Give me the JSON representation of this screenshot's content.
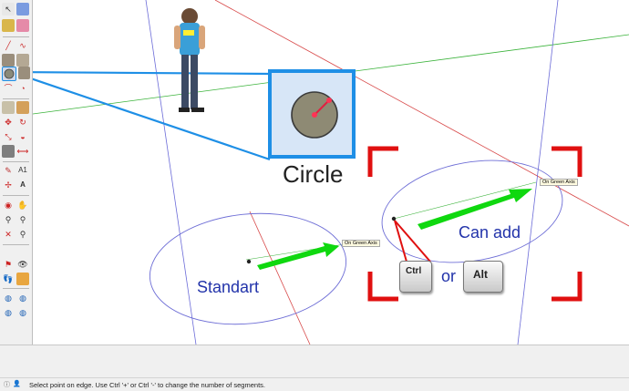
{
  "status_bar": {
    "message": "Select point on edge. Use Ctrl '+' or Ctrl '-' to change the number of segments.",
    "icons": [
      "info-icon",
      "user-icon"
    ]
  },
  "callout": {
    "title": "Circle",
    "icon": "circle-tool-icon"
  },
  "inference_tags": {
    "left": "On Green Axis",
    "right": "On Green Axis"
  },
  "labels": {
    "standart": "Standart",
    "can_add": "Can add",
    "or": "or"
  },
  "keys": {
    "ctrl": "Ctrl",
    "alt": "Alt"
  },
  "colors": {
    "axis_green": "#3bb33b",
    "axis_red": "#d84a4a",
    "axis_blue": "#6b6bd8",
    "circle_blue": "#6e6ed6",
    "callout_blue": "#1e8fe6",
    "arrow_green": "#0fd80f",
    "bracket_red": "#e01010",
    "label_blue": "#2233aa"
  },
  "toolbar": {
    "icons": [
      "select-icon",
      "make-component-icon",
      "paint-bucket-icon",
      "eraser-icon",
      "line-icon",
      "freehand-icon",
      "rectangle-icon",
      "rotated-rectangle-icon",
      "circle-icon",
      "polygon-icon",
      "arc-icon",
      "pie-icon",
      "push-pull-icon",
      "offset-icon",
      "move-icon",
      "rotate-icon",
      "scale-icon",
      "follow-me-icon",
      "tape-measure-icon",
      "dimension-icon",
      "protractor-icon",
      "text-icon",
      "axes-icon",
      "3d-text-icon",
      "orbit-icon",
      "pan-icon",
      "zoom-icon",
      "zoom-window-icon",
      "zoom-extents-icon",
      "previous-view-icon",
      "position-camera-icon",
      "look-around-icon",
      "walk-icon",
      "section-plane-icon",
      "sandbox-icon",
      "extension-icon"
    ]
  }
}
